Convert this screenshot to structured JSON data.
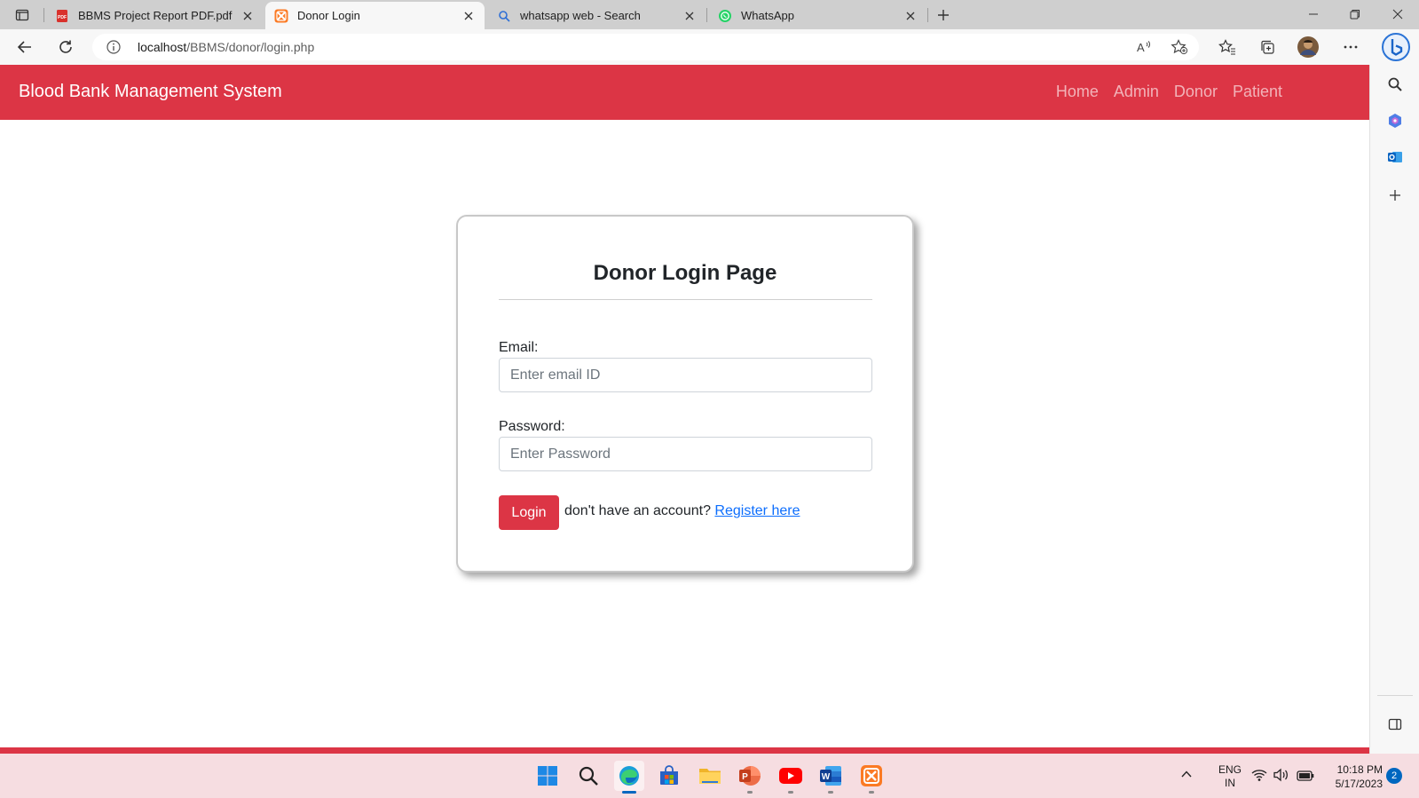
{
  "browser": {
    "tabs": [
      {
        "title": "BBMS Project Report PDF.pdf",
        "icon": "pdf-icon",
        "active": false
      },
      {
        "title": "Donor Login",
        "icon": "xampp-icon",
        "active": true
      },
      {
        "title": "whatsapp web - Search",
        "icon": "search-icon",
        "active": false
      },
      {
        "title": "WhatsApp",
        "icon": "whatsapp-icon",
        "active": false
      }
    ],
    "url_host": "localhost",
    "url_path": "/BBMS/donor/login.php"
  },
  "navbar": {
    "brand": "Blood Bank Management System",
    "links": [
      "Home",
      "Admin",
      "Donor",
      "Patient"
    ]
  },
  "login": {
    "title": "Donor Login Page",
    "email_label": "Email:",
    "email_placeholder": "Enter email ID",
    "password_label": "Password:",
    "password_placeholder": "Enter Password",
    "button_label": "Login",
    "register_prompt": "don't have an account?",
    "register_link": "Register here"
  },
  "taskbar": {
    "apps": [
      "start",
      "search",
      "edge",
      "store",
      "file-explorer",
      "powerpoint",
      "youtube",
      "word",
      "xampp"
    ],
    "lang_line1": "ENG",
    "lang_line2": "IN",
    "time": "10:18 PM",
    "date": "5/17/2023",
    "notifications": "2"
  },
  "colors": {
    "brand_red": "#dc3545",
    "link_blue": "#0d6efd",
    "taskbar_bg": "#f6dde1"
  }
}
